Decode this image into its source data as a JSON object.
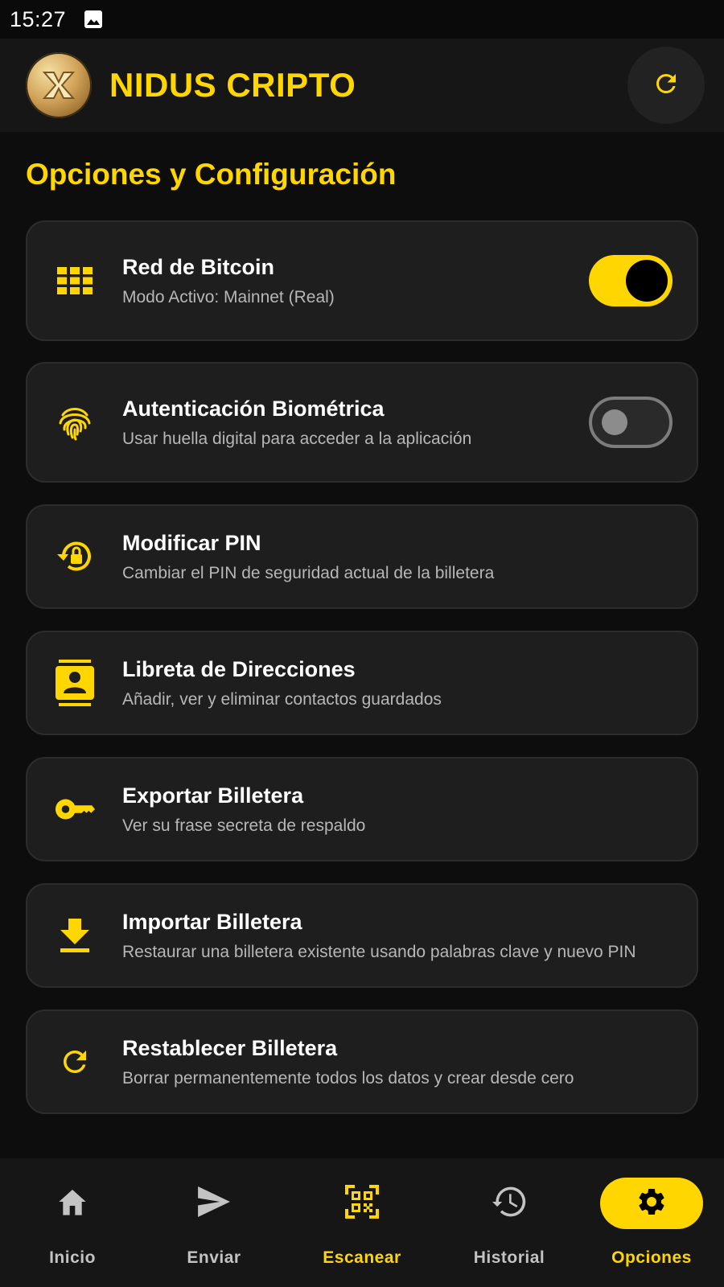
{
  "status_bar": {
    "time": "15:27",
    "notification_icon": "image-icon"
  },
  "header": {
    "title": "NIDUS CRIPTO",
    "refresh_icon": "refresh-icon"
  },
  "page": {
    "title": "Opciones y Configuración"
  },
  "settings": [
    {
      "title": "Red de Bitcoin",
      "subtitle": "Modo Activo: Mainnet (Real)",
      "icon": "grid-icon",
      "toggle": "on"
    },
    {
      "title": "Autenticación Biométrica",
      "subtitle": "Usar huella digital para acceder a la aplicación",
      "icon": "fingerprint-icon",
      "toggle": "off"
    },
    {
      "title": "Modificar PIN",
      "subtitle": "Cambiar el PIN de seguridad actual de la billetera",
      "icon": "lock-reset-icon"
    },
    {
      "title": "Libreta de Direcciones",
      "subtitle": "Añadir, ver y eliminar contactos guardados",
      "icon": "contacts-icon"
    },
    {
      "title": "Exportar Billetera",
      "subtitle": "Ver su frase secreta de respaldo",
      "icon": "key-icon"
    },
    {
      "title": "Importar Billetera",
      "subtitle": "Restaurar una billetera existente usando palabras clave y nuevo PIN",
      "icon": "download-icon"
    },
    {
      "title": "Restablecer Billetera",
      "subtitle": "Borrar permanentemente todos los datos y crear desde cero",
      "icon": "reset-icon"
    }
  ],
  "bottom_nav": [
    {
      "label": "Inicio",
      "icon": "home-icon"
    },
    {
      "label": "Enviar",
      "icon": "send-icon"
    },
    {
      "label": "Escanear",
      "icon": "qr-scan-icon"
    },
    {
      "label": "Historial",
      "icon": "history-icon"
    },
    {
      "label": "Opciones",
      "icon": "gear-icon",
      "active": true
    }
  ],
  "colors": {
    "accent": "#ffd600",
    "background": "#0d0d0d",
    "card": "#1e1e1e"
  }
}
